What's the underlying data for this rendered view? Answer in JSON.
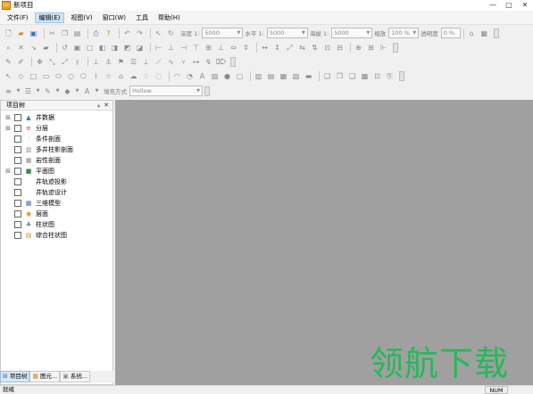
{
  "window": {
    "title": "新项目",
    "icon_text": "Corsa",
    "min_symbol": "—",
    "max_symbol": "□",
    "close_symbol": "✕"
  },
  "menu": [
    {
      "label": "文件(F)"
    },
    {
      "label": "编辑(E)"
    },
    {
      "label": "视图(V)"
    },
    {
      "label": "窗口(W)"
    },
    {
      "label": "工具"
    },
    {
      "label": "帮助(H)"
    }
  ],
  "toolbar1": {
    "depth_label": "深度 1:",
    "depth_value": "5000",
    "horizontal_label": "水平 1:",
    "horizontal_value": "5000",
    "plane_label": "海拔 1:",
    "plane_value": "5000",
    "zoom_label": "缩放",
    "zoom_value": "100 %",
    "transparency_label": "透明度",
    "transparency_value": "0 %"
  },
  "toolbar4": {
    "fill_label": "填充方式",
    "fill_value": "Hollow"
  },
  "project_panel": {
    "title": "项目树",
    "pin_symbol": "ᵩ",
    "close_symbol": "✕",
    "items": [
      {
        "label": "井数据",
        "expander": "⊞",
        "icon": "well-data-icon"
      },
      {
        "label": "分层",
        "expander": "⊞",
        "icon": "layers-icon"
      },
      {
        "label": "条件剖面",
        "expander": "",
        "icon": "conditional-section-icon"
      },
      {
        "label": "多井柱影剖面",
        "expander": "",
        "icon": "multi-well-section-icon"
      },
      {
        "label": "岩性剖面",
        "expander": "",
        "icon": "lithology-section-icon"
      },
      {
        "label": "平面图",
        "expander": "⊞",
        "icon": "plan-map-icon"
      },
      {
        "label": "井轨迹投影",
        "expander": "",
        "icon": ""
      },
      {
        "label": "井轨迹设计",
        "expander": "",
        "icon": ""
      },
      {
        "label": "三维模型",
        "expander": "",
        "icon": "3d-model-icon"
      },
      {
        "label": "层面",
        "expander": "",
        "icon": "surface-icon"
      },
      {
        "label": "柱状图",
        "expander": "",
        "icon": "column-chart-icon"
      },
      {
        "label": "综合柱状图",
        "expander": "",
        "icon": "composite-column-icon"
      }
    ],
    "tabs": [
      {
        "label": "项目树",
        "icon": "tree-tab-icon"
      },
      {
        "label": "图元...",
        "icon": "element-tab-icon"
      },
      {
        "label": "系统...",
        "icon": "system-tab-icon"
      }
    ]
  },
  "watermark": {
    "url": "lhdown.com",
    "text": "领航下载"
  },
  "status": {
    "text": "就绪",
    "num": "NUM"
  },
  "colors": {
    "workspace": "#a0a0a0",
    "watermark_green": "#24b85a",
    "active_menu": "#cce4f7"
  }
}
